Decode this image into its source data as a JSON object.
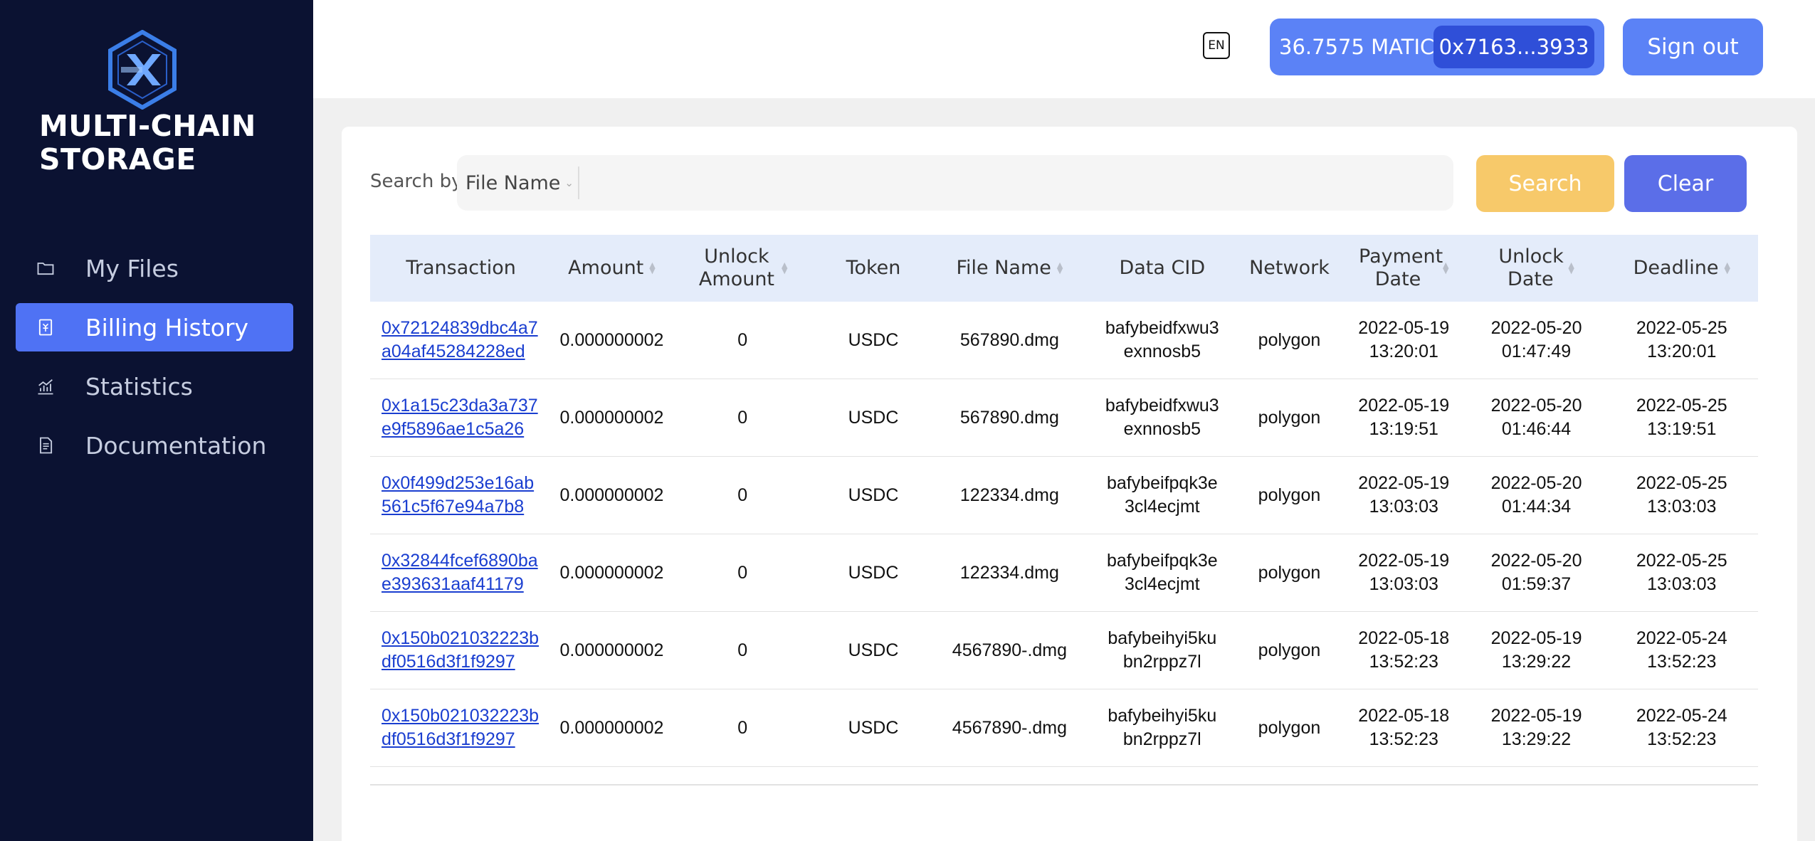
{
  "sidebar": {
    "logo_text": "MULTI-CHAIN\nSTORAGE",
    "items": [
      {
        "label": "My Files",
        "icon": "folder-icon",
        "active": false
      },
      {
        "label": "Billing History",
        "icon": "receipt-icon",
        "active": true
      },
      {
        "label": "Statistics",
        "icon": "chart-icon",
        "active": false
      },
      {
        "label": "Documentation",
        "icon": "document-icon",
        "active": false
      }
    ]
  },
  "header": {
    "language": "EN",
    "balance": "36.7575 MATIC",
    "address": "0x7163...3933",
    "signout_label": "Sign out"
  },
  "search": {
    "label": "Search by",
    "field": "File Name",
    "value": "",
    "search_label": "Search",
    "clear_label": "Clear"
  },
  "table": {
    "columns": [
      "Transaction",
      "Amount",
      "Unlock Amount",
      "Token",
      "File Name",
      "Data CID",
      "Network",
      "Payment Date",
      "Unlock Date",
      "Deadline"
    ],
    "rows": [
      {
        "transaction": "0x72124839dbc4a7a04af45284228ed",
        "amount": "0.000000002",
        "unlock_amount": "0",
        "token": "USDC",
        "file_name": "567890.dmg",
        "data_cid": "bafybeidfxwu3exnnosb5",
        "network": "polygon",
        "payment_date": "2022-05-19\n13:20:01",
        "unlock_date": "2022-05-20\n01:47:49",
        "deadline": "2022-05-25\n13:20:01"
      },
      {
        "transaction": "0x1a15c23da3a737e9f5896ae1c5a26",
        "amount": "0.000000002",
        "unlock_amount": "0",
        "token": "USDC",
        "file_name": "567890.dmg",
        "data_cid": "bafybeidfxwu3exnnosb5",
        "network": "polygon",
        "payment_date": "2022-05-19\n13:19:51",
        "unlock_date": "2022-05-20\n01:46:44",
        "deadline": "2022-05-25\n13:19:51"
      },
      {
        "transaction": "0x0f499d253e16ab561c5f67e94a7b8",
        "amount": "0.000000002",
        "unlock_amount": "0",
        "token": "USDC",
        "file_name": "122334.dmg",
        "data_cid": "bafybeifpqk3e3cl4ecjmt",
        "network": "polygon",
        "payment_date": "2022-05-19\n13:03:03",
        "unlock_date": "2022-05-20\n01:44:34",
        "deadline": "2022-05-25\n13:03:03"
      },
      {
        "transaction": "0x32844fcef6890bae393631aaf41179",
        "amount": "0.000000002",
        "unlock_amount": "0",
        "token": "USDC",
        "file_name": "122334.dmg",
        "data_cid": "bafybeifpqk3e3cl4ecjmt",
        "network": "polygon",
        "payment_date": "2022-05-19\n13:03:03",
        "unlock_date": "2022-05-20\n01:59:37",
        "deadline": "2022-05-25\n13:03:03"
      },
      {
        "transaction": "0x150b021032223bdf0516d3f1f9297",
        "amount": "0.000000002",
        "unlock_amount": "0",
        "token": "USDC",
        "file_name": "4567890-.dmg",
        "data_cid": "bafybeihyi5kubn2rppz7l",
        "network": "polygon",
        "payment_date": "2022-05-18\n13:52:23",
        "unlock_date": "2022-05-19\n13:29:22",
        "deadline": "2022-05-24\n13:52:23"
      },
      {
        "transaction": "0x150b021032223bdf0516d3f1f9297",
        "amount": "0.000000002",
        "unlock_amount": "0",
        "token": "USDC",
        "file_name": "4567890-.dmg",
        "data_cid": "bafybeihyi5kubn2rppz7l",
        "network": "polygon",
        "payment_date": "2022-05-18\n13:52:23",
        "unlock_date": "2022-05-19\n13:29:22",
        "deadline": "2022-05-24\n13:52:23"
      }
    ]
  }
}
